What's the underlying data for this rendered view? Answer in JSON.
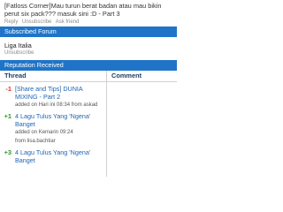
{
  "notification": {
    "title": "[Fatloss Corner]Mau turun berat badan atau mau bikin perut six pack??? masuk sini :D - Part 3",
    "reply_label": "Reply",
    "unsubscribe_label": "Unsubscribe",
    "ask_friend_label": "Ask friend"
  },
  "subscribed_forum": {
    "header": "Subscribed Forum",
    "forum_name": "Liga Italia",
    "unsubscribe_label": "Unsubscribe"
  },
  "reputation": {
    "header": "Reputation Received",
    "columns": {
      "thread": "Thread",
      "comment": "Comment"
    },
    "items": [
      {
        "score": "-1",
        "thread": "[Share and Tips] DUNIA MIXING - Part 2",
        "added": "added on Hari ini 08:34  from askad"
      },
      {
        "score": "+1",
        "thread": "4 Lagu Tulus Yang 'Ngena' Banget",
        "added": "added on Kemarin 09:24",
        "from": "from lisa.bachtiar"
      },
      {
        "score": "+3",
        "thread": "4 Lagu Tulus Yang 'Ngena' Banget",
        "added": ""
      }
    ]
  },
  "colors": {
    "header_bg": "#1f74c8",
    "link": "#1e64b4",
    "negative": "#d9342b",
    "positive": "#2a9a2a"
  }
}
